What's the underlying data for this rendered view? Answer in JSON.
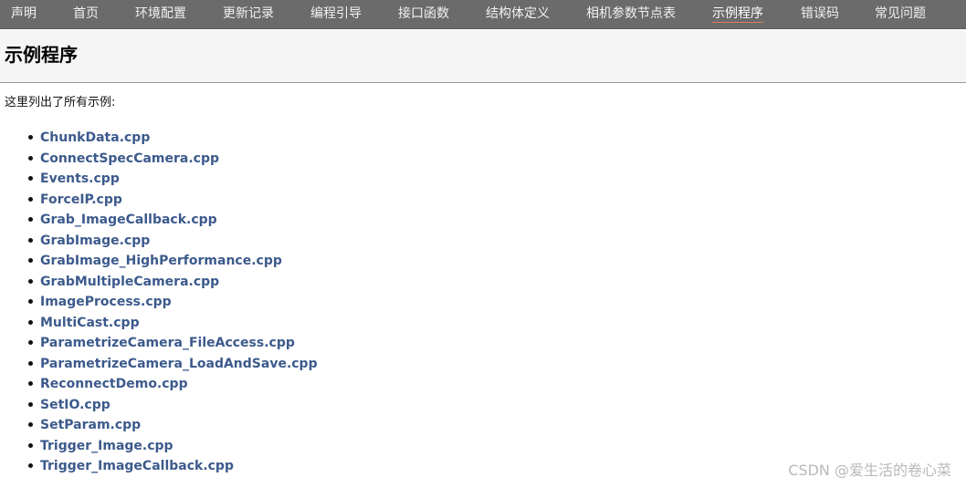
{
  "nav": {
    "items": [
      {
        "label": "声明"
      },
      {
        "label": "首页"
      },
      {
        "label": "环境配置"
      },
      {
        "label": "更新记录"
      },
      {
        "label": "编程引导"
      },
      {
        "label": "接口函数"
      },
      {
        "label": "结构体定义"
      },
      {
        "label": "相机参数节点表"
      },
      {
        "label": "示例程序",
        "active": true
      },
      {
        "label": "错误码"
      },
      {
        "label": "常见问题"
      }
    ]
  },
  "page": {
    "title": "示例程序",
    "intro": "这里列出了所有示例:"
  },
  "examples": [
    "ChunkData.cpp",
    "ConnectSpecCamera.cpp",
    "Events.cpp",
    "ForceIP.cpp",
    "Grab_ImageCallback.cpp",
    "GrabImage.cpp",
    "GrabImage_HighPerformance.cpp",
    "GrabMultipleCamera.cpp",
    "ImageProcess.cpp",
    "MultiCast.cpp",
    "ParametrizeCamera_FileAccess.cpp",
    "ParametrizeCamera_LoadAndSave.cpp",
    "ReconnectDemo.cpp",
    "SetIO.cpp",
    "SetParam.cpp",
    "Trigger_Image.cpp",
    "Trigger_ImageCallback.cpp"
  ],
  "watermark": "CSDN @爱生活的卷心菜",
  "colors": {
    "nav_background": "#6b6b6b",
    "link": "#3c5a8c",
    "active_underline": "#e0794f"
  }
}
